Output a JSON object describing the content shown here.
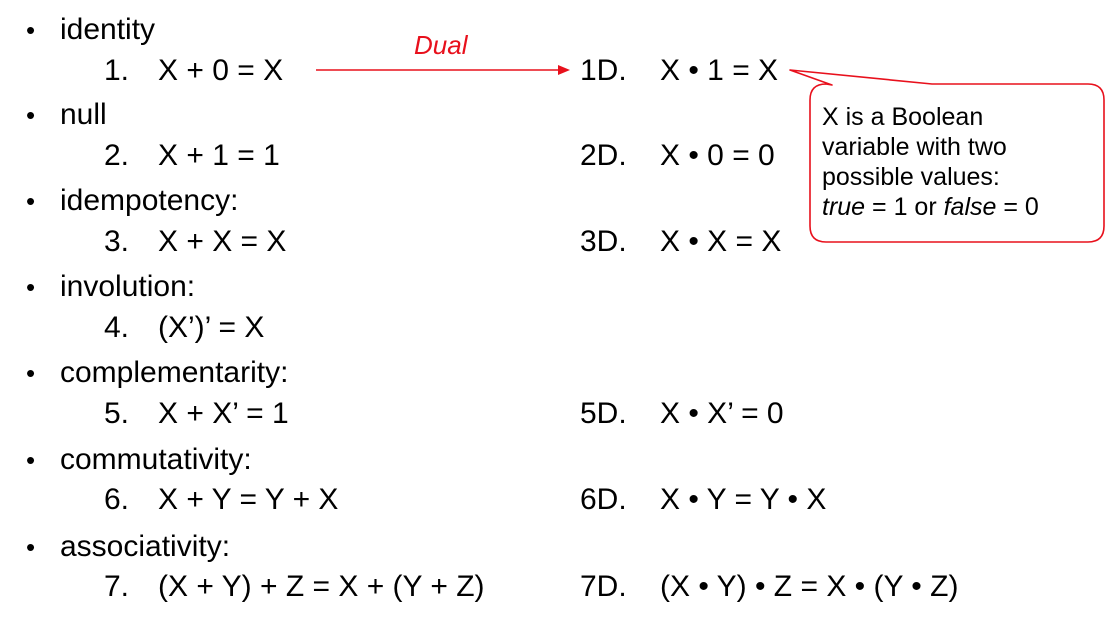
{
  "bullet_char": "•",
  "sections": [
    {
      "heading": "identity",
      "num": "1.",
      "law": "X + 0 = X",
      "dual_num": "1D.",
      "dual_law": "X • 1 = X"
    },
    {
      "heading": "null",
      "num": "2.",
      "law": "X + 1 = 1",
      "dual_num": "2D.",
      "dual_law": "X • 0 = 0"
    },
    {
      "heading": "idempotency:",
      "num": "3.",
      "law": "X + X = X",
      "dual_num": "3D.",
      "dual_law": "X • X = X"
    },
    {
      "heading": "involution:",
      "num": "4.",
      "law": "(X’)’ = X"
    },
    {
      "heading": "complementarity:",
      "num": "5.",
      "law": "X + X’ = 1",
      "dual_num": "5D.",
      "dual_law": "X • X’ = 0"
    },
    {
      "heading": "commutativity:",
      "num": "6.",
      "law": "X + Y = Y + X",
      "dual_num": "6D.",
      "dual_law": "X • Y = Y • X"
    },
    {
      "heading": "associativity:",
      "num": "7.",
      "law": "(X + Y) + Z = X + (Y + Z)",
      "dual_num": "7D.",
      "dual_law": "(X • Y) • Z = X • (Y • Z)"
    }
  ],
  "dual_arrow_label": "Dual",
  "callout": {
    "line1": "X is a Boolean",
    "line2": "variable with two",
    "line3": "possible values:",
    "true_word": "true",
    "true_value": " = 1 or ",
    "false_word": "false",
    "false_value": " = 0"
  },
  "colors": {
    "accent_red": "#e8101c",
    "text": "#000000",
    "background": "#ffffff"
  }
}
